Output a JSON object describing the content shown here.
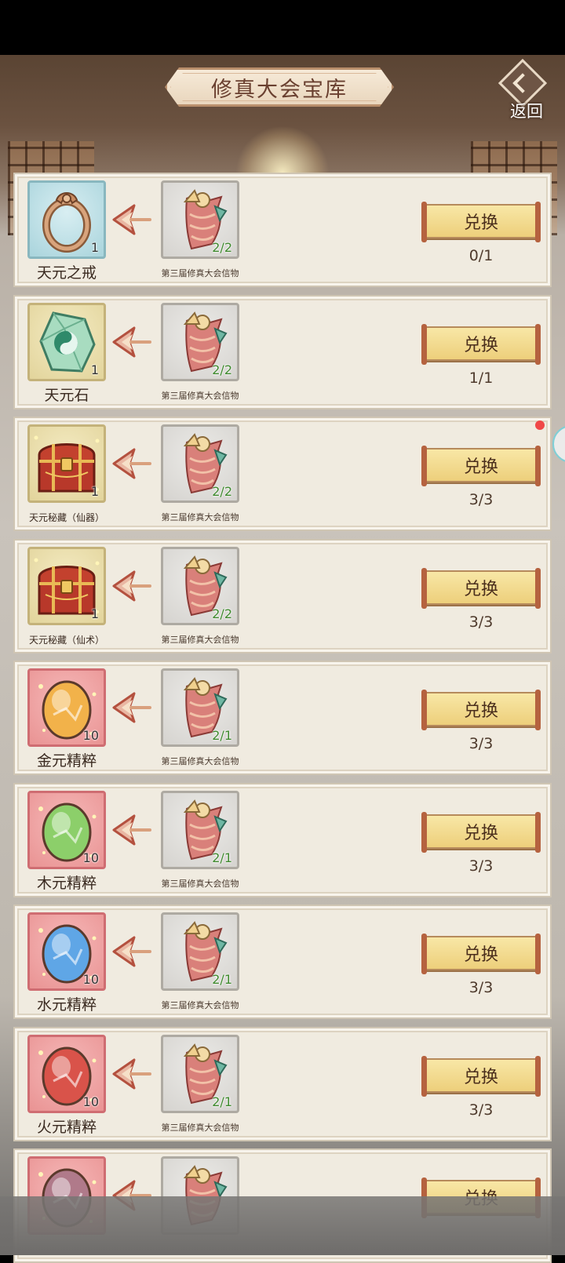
{
  "header": {
    "title": "修真大会宝库",
    "back_label": "返回"
  },
  "rows": [
    {
      "name": "天元之戒",
      "item_count": "1",
      "icon": "ring-icon",
      "tile": "blue",
      "cost_name": "第三届修真大会信物",
      "cost_count": "2/2",
      "button": "兑换",
      "limit": "0/1"
    },
    {
      "name": "天元石",
      "item_count": "1",
      "icon": "jade-stone-icon",
      "tile": "yellow",
      "cost_name": "第三届修真大会信物",
      "cost_count": "2/2",
      "button": "兑换",
      "limit": "1/1"
    },
    {
      "name": "天元秘藏（仙器）",
      "item_count": "1",
      "icon": "treasure-chest-icon",
      "tile": "yellow",
      "cost_name": "第三届修真大会信物",
      "cost_count": "2/2",
      "button": "兑换",
      "limit": "3/3"
    },
    {
      "name": "天元秘藏（仙术）",
      "item_count": "1",
      "icon": "treasure-chest-icon",
      "tile": "yellow",
      "cost_name": "第三届修真大会信物",
      "cost_count": "2/2",
      "button": "兑换",
      "limit": "3/3"
    },
    {
      "name": "金元精粹",
      "item_count": "10",
      "icon": "gold-essence-icon",
      "tile": "red",
      "cost_name": "第三届修真大会信物",
      "cost_count": "2/1",
      "button": "兑换",
      "limit": "3/3"
    },
    {
      "name": "木元精粹",
      "item_count": "10",
      "icon": "wood-essence-icon",
      "tile": "red",
      "cost_name": "第三届修真大会信物",
      "cost_count": "2/1",
      "button": "兑换",
      "limit": "3/3"
    },
    {
      "name": "水元精粹",
      "item_count": "10",
      "icon": "water-essence-icon",
      "tile": "red",
      "cost_name": "第三届修真大会信物",
      "cost_count": "2/1",
      "button": "兑换",
      "limit": "3/3"
    },
    {
      "name": "火元精粹",
      "item_count": "10",
      "icon": "fire-essence-icon",
      "tile": "red",
      "cost_name": "第三届修真大会信物",
      "cost_count": "2/1",
      "button": "兑换",
      "limit": "3/3"
    },
    {
      "name": "",
      "item_count": "",
      "icon": "earth-essence-icon",
      "tile": "red",
      "cost_name": "",
      "cost_count": "",
      "button": "兑换",
      "limit": ""
    }
  ],
  "colors": {
    "essence_gold": "#f2b24a",
    "essence_wood": "#8ccf6a",
    "essence_water": "#5fa6e6",
    "essence_fire": "#d9534a",
    "essence_earth": "#b07a8a"
  }
}
